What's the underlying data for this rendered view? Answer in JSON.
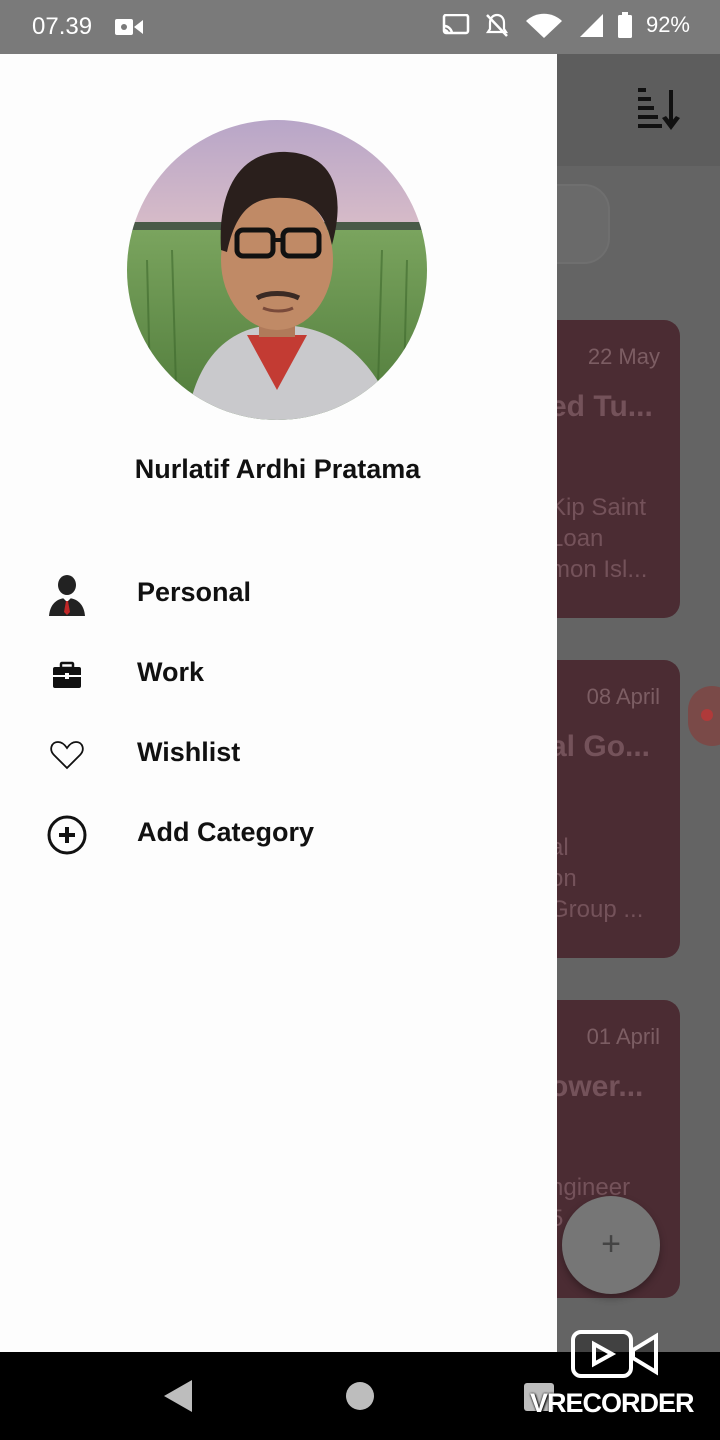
{
  "status_bar": {
    "time": "07.39",
    "battery_percent": "92%",
    "icons": [
      "video-record-icon",
      "cast-icon",
      "bell-off-icon",
      "wifi-icon",
      "signal-icon",
      "battery-icon"
    ]
  },
  "background": {
    "sort_icon": "sort-descending-icon",
    "cards": [
      {
        "date": "22 May",
        "title": "ed Tu...",
        "description": "Kip Saint\nLoan\nmon Isl..."
      },
      {
        "date": "08 April",
        "title": "al Go...",
        "description": "al\non\nGroup ..."
      },
      {
        "date": "01 April",
        "title": "ower...",
        "description": "ngineer\n5"
      }
    ],
    "fab_label": "+",
    "card_color": "#4b2c33"
  },
  "drawer": {
    "user_name": "Nurlatif Ardhi Pratama",
    "menu": [
      {
        "label": "Personal",
        "icon": "businessman-icon"
      },
      {
        "label": "Work",
        "icon": "briefcase-icon"
      },
      {
        "label": "Wishlist",
        "icon": "heart-icon"
      },
      {
        "label": "Add Category",
        "icon": "add-circle-icon"
      }
    ]
  },
  "watermark": {
    "text": "RECORDER",
    "prefix": "V"
  }
}
